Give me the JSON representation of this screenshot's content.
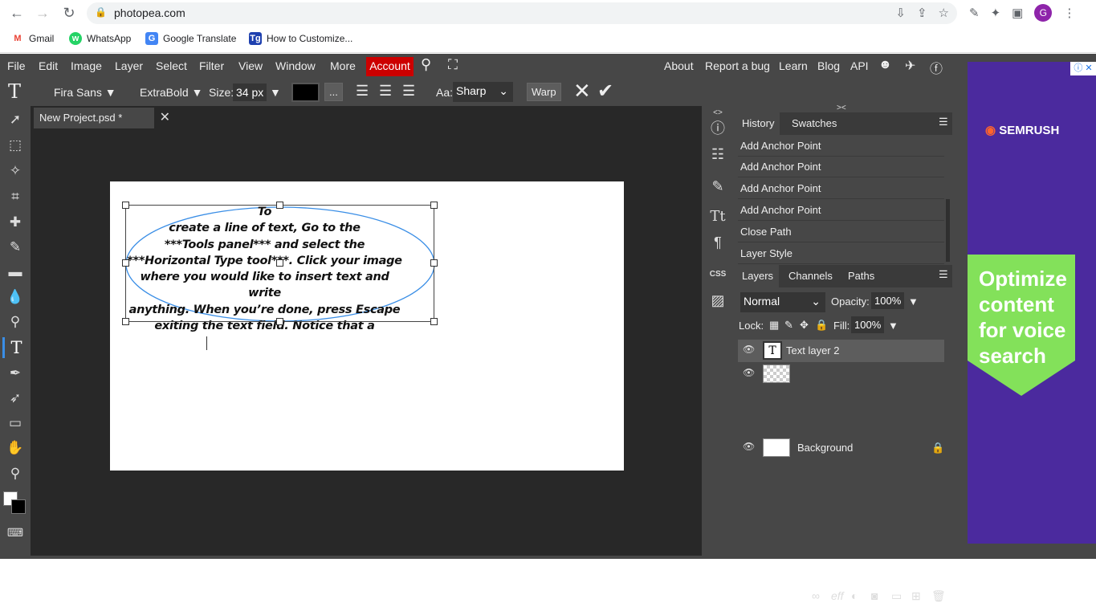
{
  "browser": {
    "url": "photopea.com",
    "avatar_letter": "G"
  },
  "bookmarks": [
    {
      "label": "Gmail"
    },
    {
      "label": "WhatsApp"
    },
    {
      "label": "Google Translate"
    },
    {
      "label": "How to Customize..."
    }
  ],
  "menu": {
    "items": [
      "File",
      "Edit",
      "Image",
      "Layer",
      "Select",
      "Filter",
      "View",
      "Window",
      "More"
    ],
    "account": "Account",
    "right": [
      "About",
      "Report a bug",
      "Learn",
      "Blog",
      "API"
    ]
  },
  "options": {
    "font_family": "Fira Sans ▼",
    "font_weight": "ExtraBold ▼",
    "size_label": "Size:",
    "size_value": "34 px",
    "more": "...",
    "aa_label": "Aa:",
    "aa_value": "Sharp",
    "warp": "Warp"
  },
  "document": {
    "tab_title": "New Project.psd *",
    "text_lines": [
      "To",
      "create a line of text, Go to the",
      "***Tools panel*** and select the",
      "***Horizontal Type tool***. Click your image",
      "where you would like to insert text and write",
      "anything. When you’re done, press Escape",
      "exiting the text field. Notice that a"
    ]
  },
  "history": {
    "tabs": [
      "History",
      "Swatches"
    ],
    "rows": [
      "Add Anchor Point",
      "Add Anchor Point",
      "Add Anchor Point",
      "Add Anchor Point",
      "Close Path",
      "Layer Style"
    ]
  },
  "layers": {
    "tabs": [
      "Layers",
      "Channels",
      "Paths"
    ],
    "blend_mode": "Normal",
    "opacity_label": "Opacity:",
    "opacity_value": "100%",
    "lock_label": "Lock:",
    "fill_label": "Fill:",
    "fill_value": "100%",
    "rows": [
      "Text layer 2",
      "",
      "Background"
    ]
  },
  "ad": {
    "brand": "SEMRUSH",
    "headline": "Optimize content for voice search"
  }
}
